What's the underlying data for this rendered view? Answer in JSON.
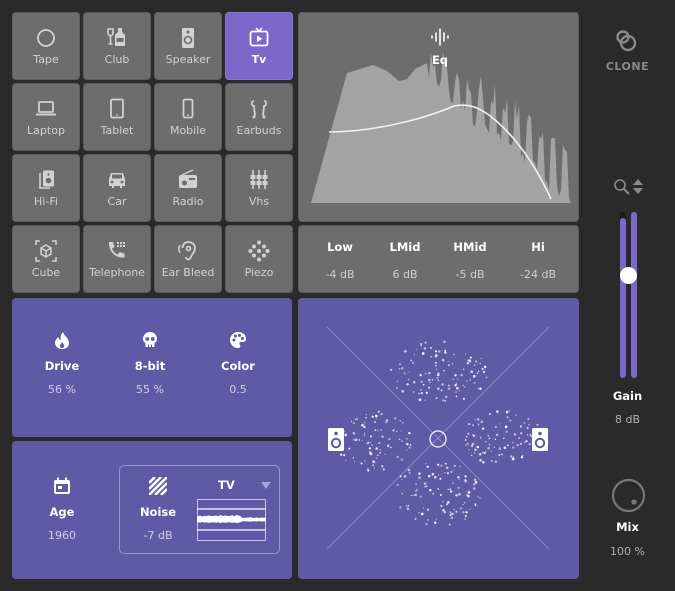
{
  "presets": [
    {
      "label": "Tape",
      "icon": "circle-icon",
      "active": false
    },
    {
      "label": "Club",
      "icon": "bottle-glass-icon",
      "active": false
    },
    {
      "label": "Speaker",
      "icon": "speaker-icon",
      "active": false
    },
    {
      "label": "Tv",
      "icon": "tv-icon",
      "active": true
    },
    {
      "label": "Laptop",
      "icon": "laptop-icon",
      "active": false
    },
    {
      "label": "Tablet",
      "icon": "tablet-icon",
      "active": false
    },
    {
      "label": "Mobile",
      "icon": "mobile-icon",
      "active": false
    },
    {
      "label": "Earbuds",
      "icon": "earbuds-icon",
      "active": false
    },
    {
      "label": "Hi-Fi",
      "icon": "hifi-icon",
      "active": false
    },
    {
      "label": "Car",
      "icon": "car-icon",
      "active": false
    },
    {
      "label": "Radio",
      "icon": "radio-icon",
      "active": false
    },
    {
      "label": "Vhs",
      "icon": "vhs-sliders-icon",
      "active": false
    },
    {
      "label": "Cube",
      "icon": "cube-icon",
      "active": false
    },
    {
      "label": "Telephone",
      "icon": "telephone-icon",
      "active": false
    },
    {
      "label": "Ear Bleed",
      "icon": "ear-icon",
      "active": false
    },
    {
      "label": "Piezo",
      "icon": "piezo-dots-icon",
      "active": false
    }
  ],
  "eq": {
    "title": "Eq",
    "bands": [
      {
        "name": "Low",
        "value": "-4 dB"
      },
      {
        "name": "LMid",
        "value": "6 dB"
      },
      {
        "name": "HMid",
        "value": "-5 dB"
      },
      {
        "name": "Hi",
        "value": "-24 dB"
      }
    ]
  },
  "character": {
    "drive": {
      "label": "Drive",
      "value": "56 %"
    },
    "bit8": {
      "label": "8-bit",
      "value": "55 %"
    },
    "color": {
      "label": "Color",
      "value": "0.5"
    }
  },
  "age": {
    "label": "Age",
    "value": "1960"
  },
  "noise": {
    "label": "Noise",
    "value": "-7 dB",
    "type": "TV"
  },
  "brand": {
    "name": "CLONE"
  },
  "gain": {
    "label": "Gain",
    "value": "8 dB",
    "level": 0.62
  },
  "mix": {
    "label": "Mix",
    "value": "100 %",
    "level": 1.0
  },
  "colors": {
    "accent": "#7b68c8",
    "panel_purple": "#5f59a6",
    "tile": "#6d6d6d",
    "background": "#2a2a2a"
  }
}
